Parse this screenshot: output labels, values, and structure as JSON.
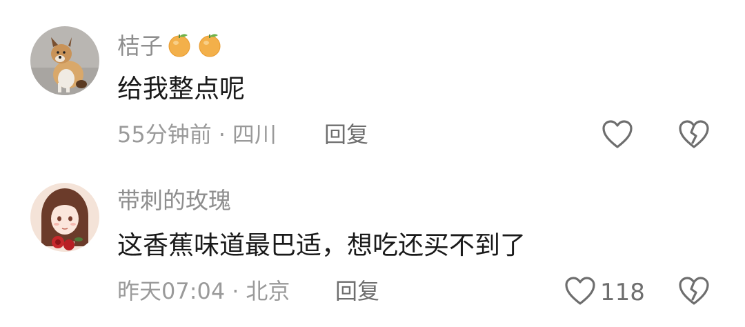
{
  "comments": [
    {
      "username": "桔子",
      "badge_icons": [
        "orange-emoji-icon",
        "orange-emoji-icon"
      ],
      "text": "给我整点呢",
      "time": "55分钟前",
      "separator": "·",
      "location": "四川",
      "reply_label": "回复",
      "like_count": "",
      "avatar": "dog-avatar"
    },
    {
      "username": "带刺的玫瑰",
      "badge_icons": [],
      "text": "这香蕉味道最巴适，想吃还买不到了",
      "time": "昨天07:04",
      "separator": "·",
      "location": "北京",
      "reply_label": "回复",
      "like_count": "118",
      "avatar": "girl-illustration-avatar"
    }
  ],
  "icons": {
    "like": "heart-outline-icon",
    "dislike": "broken-heart-icon"
  },
  "colors": {
    "username": "#8e8e8e",
    "text": "#1a1a1a",
    "meta": "#9a9a9a",
    "icon": "#6e6e6e",
    "orange": "#f3b04a"
  }
}
